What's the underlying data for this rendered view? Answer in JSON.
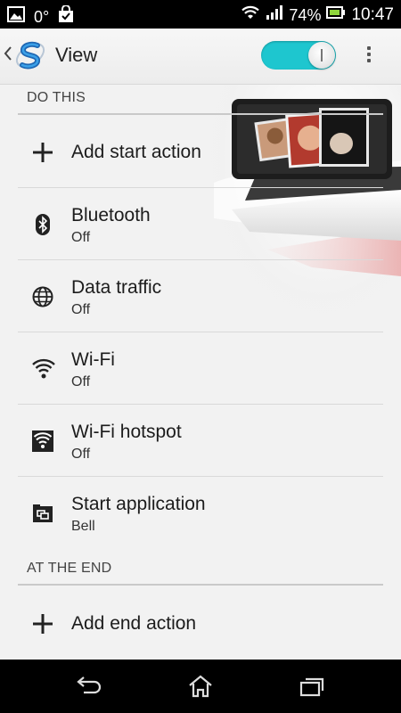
{
  "status_bar": {
    "temperature": "0°",
    "battery_percent": "74%",
    "time": "10:47"
  },
  "action_bar": {
    "title": "View",
    "toggle_on": true
  },
  "sections": {
    "do_this": "DO THIS",
    "at_the_end": "AT THE END"
  },
  "actions": {
    "add_start": "Add start action",
    "bluetooth": {
      "label": "Bluetooth",
      "value": "Off"
    },
    "data_traffic": {
      "label": "Data traffic",
      "value": "Off"
    },
    "wifi": {
      "label": "Wi-Fi",
      "value": "Off"
    },
    "wifi_hotspot": {
      "label": "Wi-Fi hotspot",
      "value": "Off"
    },
    "start_app": {
      "label": "Start application",
      "value": "Bell"
    },
    "add_end": "Add end action"
  },
  "colors": {
    "toggle": "#1ec6cf",
    "background": "#f2f2f2"
  }
}
